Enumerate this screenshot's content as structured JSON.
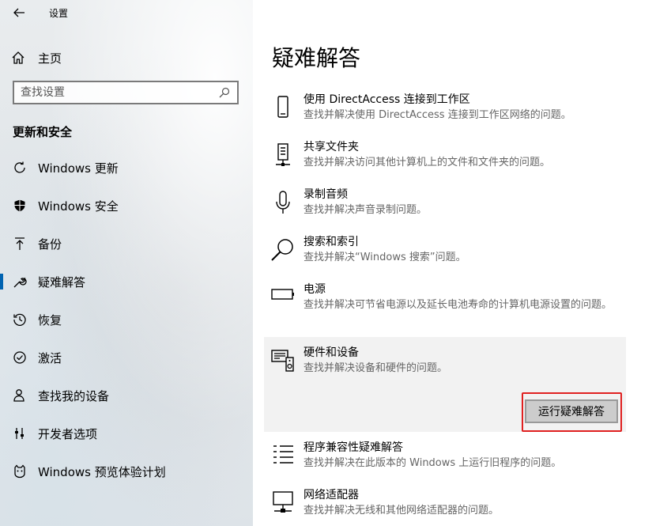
{
  "window": {
    "title": "设置"
  },
  "sidebar": {
    "home_label": "主页",
    "search_placeholder": "查找设置",
    "section_title": "更新和安全",
    "items": [
      {
        "label": "Windows 更新",
        "icon": "sync-icon"
      },
      {
        "label": "Windows 安全",
        "icon": "shield-icon"
      },
      {
        "label": "备份",
        "icon": "backup-arrow-icon"
      },
      {
        "label": "疑难解答",
        "icon": "wrench-icon",
        "active": true
      },
      {
        "label": "恢复",
        "icon": "recovery-icon"
      },
      {
        "label": "激活",
        "icon": "check-circle-icon"
      },
      {
        "label": "查找我的设备",
        "icon": "person-icon"
      },
      {
        "label": "开发者选项",
        "icon": "developer-icon"
      },
      {
        "label": "Windows 预览体验计划",
        "icon": "insider-cat-icon"
      }
    ]
  },
  "main": {
    "title": "疑难解答",
    "items": [
      {
        "title": "使用 DirectAccess 连接到工作区",
        "desc": "查找并解决使用 DirectAccess 连接到工作区网络的问题。",
        "icon": "phone-icon"
      },
      {
        "title": "共享文件夹",
        "desc": "查找并解决访问其他计算机上的文件和文件夹的问题。",
        "icon": "network-tower-icon"
      },
      {
        "title": "录制音频",
        "desc": "查找并解决声音录制问题。",
        "icon": "microphone-icon"
      },
      {
        "title": "搜索和索引",
        "desc": "查找并解决“Windows 搜索”问题。",
        "icon": "search-icon"
      },
      {
        "title": "电源",
        "desc": "查找并解决可节省电源以及延长电池寿命的计算机电源设置的问题。",
        "icon": "battery-icon"
      },
      {
        "title": "硬件和设备",
        "desc": "查找并解决设备和硬件的问题。",
        "icon": "hardware-icon",
        "selected": true
      },
      {
        "title": "程序兼容性疑难解答",
        "desc": "查找并解决在此版本的 Windows 上运行旧程序的问题。",
        "icon": "list-icon"
      },
      {
        "title": "网络适配器",
        "desc": "查找并解决无线和其他网络适配器的问题。",
        "icon": "monitor-network-icon"
      }
    ],
    "run_button": "运行疑难解答"
  },
  "colors": {
    "accent": "#0063b1",
    "highlight_border": "#e02020"
  }
}
